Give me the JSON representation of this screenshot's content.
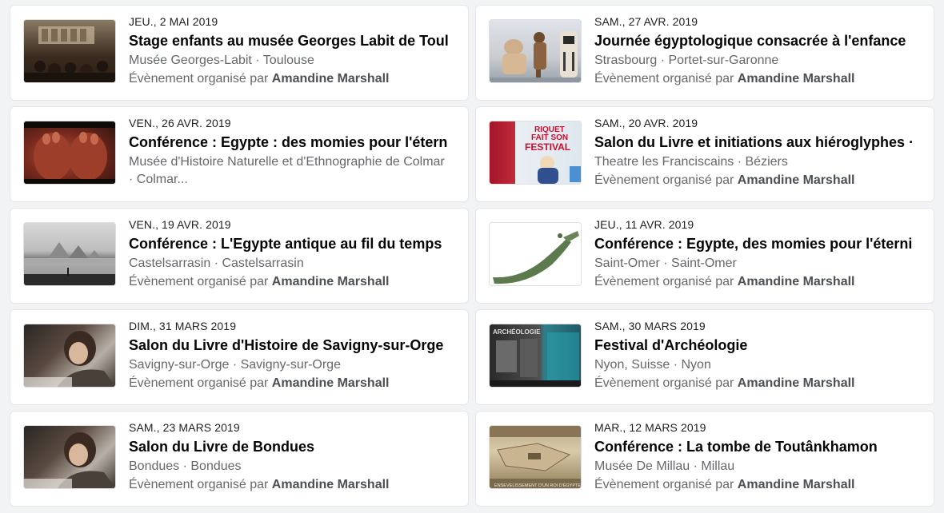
{
  "events": [
    {
      "date": "JEU., 2 MAI 2019",
      "title": "Stage enfants au musée Georges Labit de Toul",
      "location": "Musée Georges-Labit · Toulouse",
      "organizer_prefix": "Évènement organisé par",
      "organizer": "Amandine Marshall",
      "thumb": "museum-photo"
    },
    {
      "date": "SAM., 27 AVR. 2019",
      "title": "Journée égyptologique consacrée à l'enfance",
      "location": "Strasbourg · Portet-sur-Garonne",
      "organizer_prefix": "Évènement organisé par",
      "organizer": "Amandine Marshall",
      "thumb": "statues-photo"
    },
    {
      "date": "VEN., 26 AVR. 2019",
      "title": "Conférence : Egypte : des momies pour l'étern",
      "location": "Musée d'Histoire Naturelle et d'Ethnographie de Colmar · Colmar...",
      "organizer_prefix": "",
      "organizer": "",
      "thumb": "mummy-photo"
    },
    {
      "date": "SAM., 20 AVR. 2019",
      "title": "Salon du Livre et initiations aux hiéroglyphes ·",
      "location": "Theatre les Franciscains · Béziers",
      "organizer_prefix": "Évènement organisé par",
      "organizer": "Amandine Marshall",
      "thumb": "festival-poster"
    },
    {
      "date": "VEN., 19 AVR. 2019",
      "title": "Conférence : L'Egypte antique au fil du temps",
      "location": "Castelsarrasin · Castelsarrasin",
      "organizer_prefix": "Évènement organisé par",
      "organizer": "Amandine Marshall",
      "thumb": "pyramids-photo"
    },
    {
      "date": "JEU., 11 AVR. 2019",
      "title": "Conférence : Egypte, des momies pour l'éterni",
      "location": "Saint-Omer · Saint-Omer",
      "organizer_prefix": "Évènement organisé par",
      "organizer": "Amandine Marshall",
      "thumb": "sword-photo"
    },
    {
      "date": "DIM., 31 MARS 2019",
      "title": "Salon du Livre d'Histoire de Savigny-sur-Orge",
      "location": "Savigny-sur-Orge · Savigny-sur-Orge",
      "organizer_prefix": "Évènement organisé par",
      "organizer": "Amandine Marshall",
      "thumb": "author-photo"
    },
    {
      "date": "SAM., 30 MARS 2019",
      "title": "Festival d'Archéologie",
      "location": "Nyon, Suisse · Nyon",
      "organizer_prefix": "Évènement organisé par",
      "organizer": "Amandine Marshall",
      "thumb": "archeology-poster"
    },
    {
      "date": "SAM., 23 MARS 2019",
      "title": "Salon du Livre de Bondues",
      "location": "Bondues · Bondues",
      "organizer_prefix": "Évènement organisé par",
      "organizer": "Amandine Marshall",
      "thumb": "author-photo"
    },
    {
      "date": "MAR., 12 MARS 2019",
      "title": "Conférence : La tombe de Toutânkhamon",
      "location": "Musée De Millau · Millau",
      "organizer_prefix": "Évènement organisé par",
      "organizer": "Amandine Marshall",
      "thumb": "tomb-illustration"
    }
  ],
  "thumb_texts": {
    "festival_line1": "RIQUET",
    "festival_line2": "FAIT SON",
    "festival_line3": "FESTIVAL",
    "archeo_label": "ARCHÉOLOGIE",
    "tomb_caption": "ENSEVELISSEMENT D'UN ROI D'ÉGYPTE"
  },
  "colors": {
    "page_bg": "#f2f3f5",
    "card_bg": "#ffffff",
    "secondary_text": "#65676b",
    "title_text": "#050505"
  }
}
